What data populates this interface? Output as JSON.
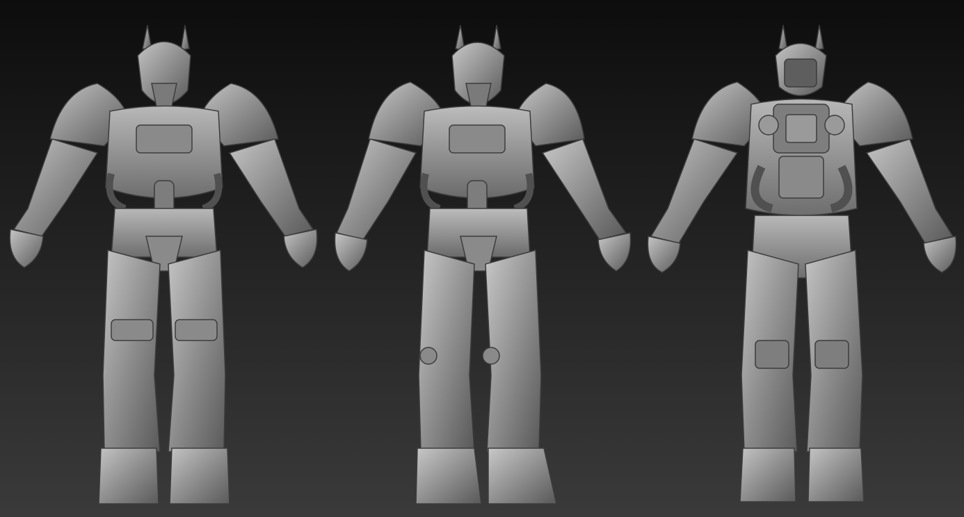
{
  "scene": {
    "background": {
      "top": "#0d0d0d",
      "bottom": "#3a3a3a"
    },
    "material_color": "#9a9a9a",
    "views": [
      {
        "name": "front"
      },
      {
        "name": "three-quarter"
      },
      {
        "name": "back"
      }
    ]
  }
}
